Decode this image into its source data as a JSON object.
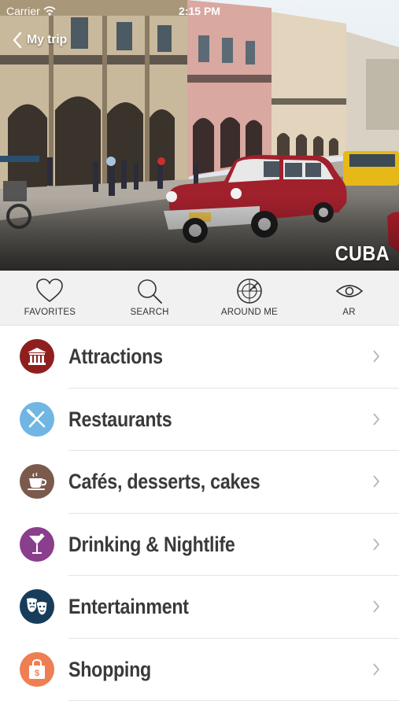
{
  "status_bar": {
    "carrier": "Carrier",
    "time": "2:15 PM"
  },
  "nav": {
    "back_label": "My trip"
  },
  "hero": {
    "country": "CUBA"
  },
  "toolbar": {
    "items": [
      {
        "label": "FAVORITES",
        "icon": "heart-icon"
      },
      {
        "label": "SEARCH",
        "icon": "search-icon"
      },
      {
        "label": "AROUND ME",
        "icon": "radar-icon"
      },
      {
        "label": "AR",
        "icon": "eye-icon"
      }
    ]
  },
  "categories": [
    {
      "label": "Attractions",
      "icon": "museum-icon",
      "color": "#8f1f1f"
    },
    {
      "label": "Restaurants",
      "icon": "cutlery-icon",
      "color": "#6fb6e3"
    },
    {
      "label": "Cafés, desserts, cakes",
      "icon": "coffee-cup-icon",
      "color": "#7b5a4c"
    },
    {
      "label": "Drinking & Nightlife",
      "icon": "cocktail-icon",
      "color": "#8a3f8c"
    },
    {
      "label": "Entertainment",
      "icon": "theater-masks-icon",
      "color": "#183d5a"
    },
    {
      "label": "Shopping",
      "icon": "shopping-bag-icon",
      "color": "#ee7f52"
    }
  ]
}
